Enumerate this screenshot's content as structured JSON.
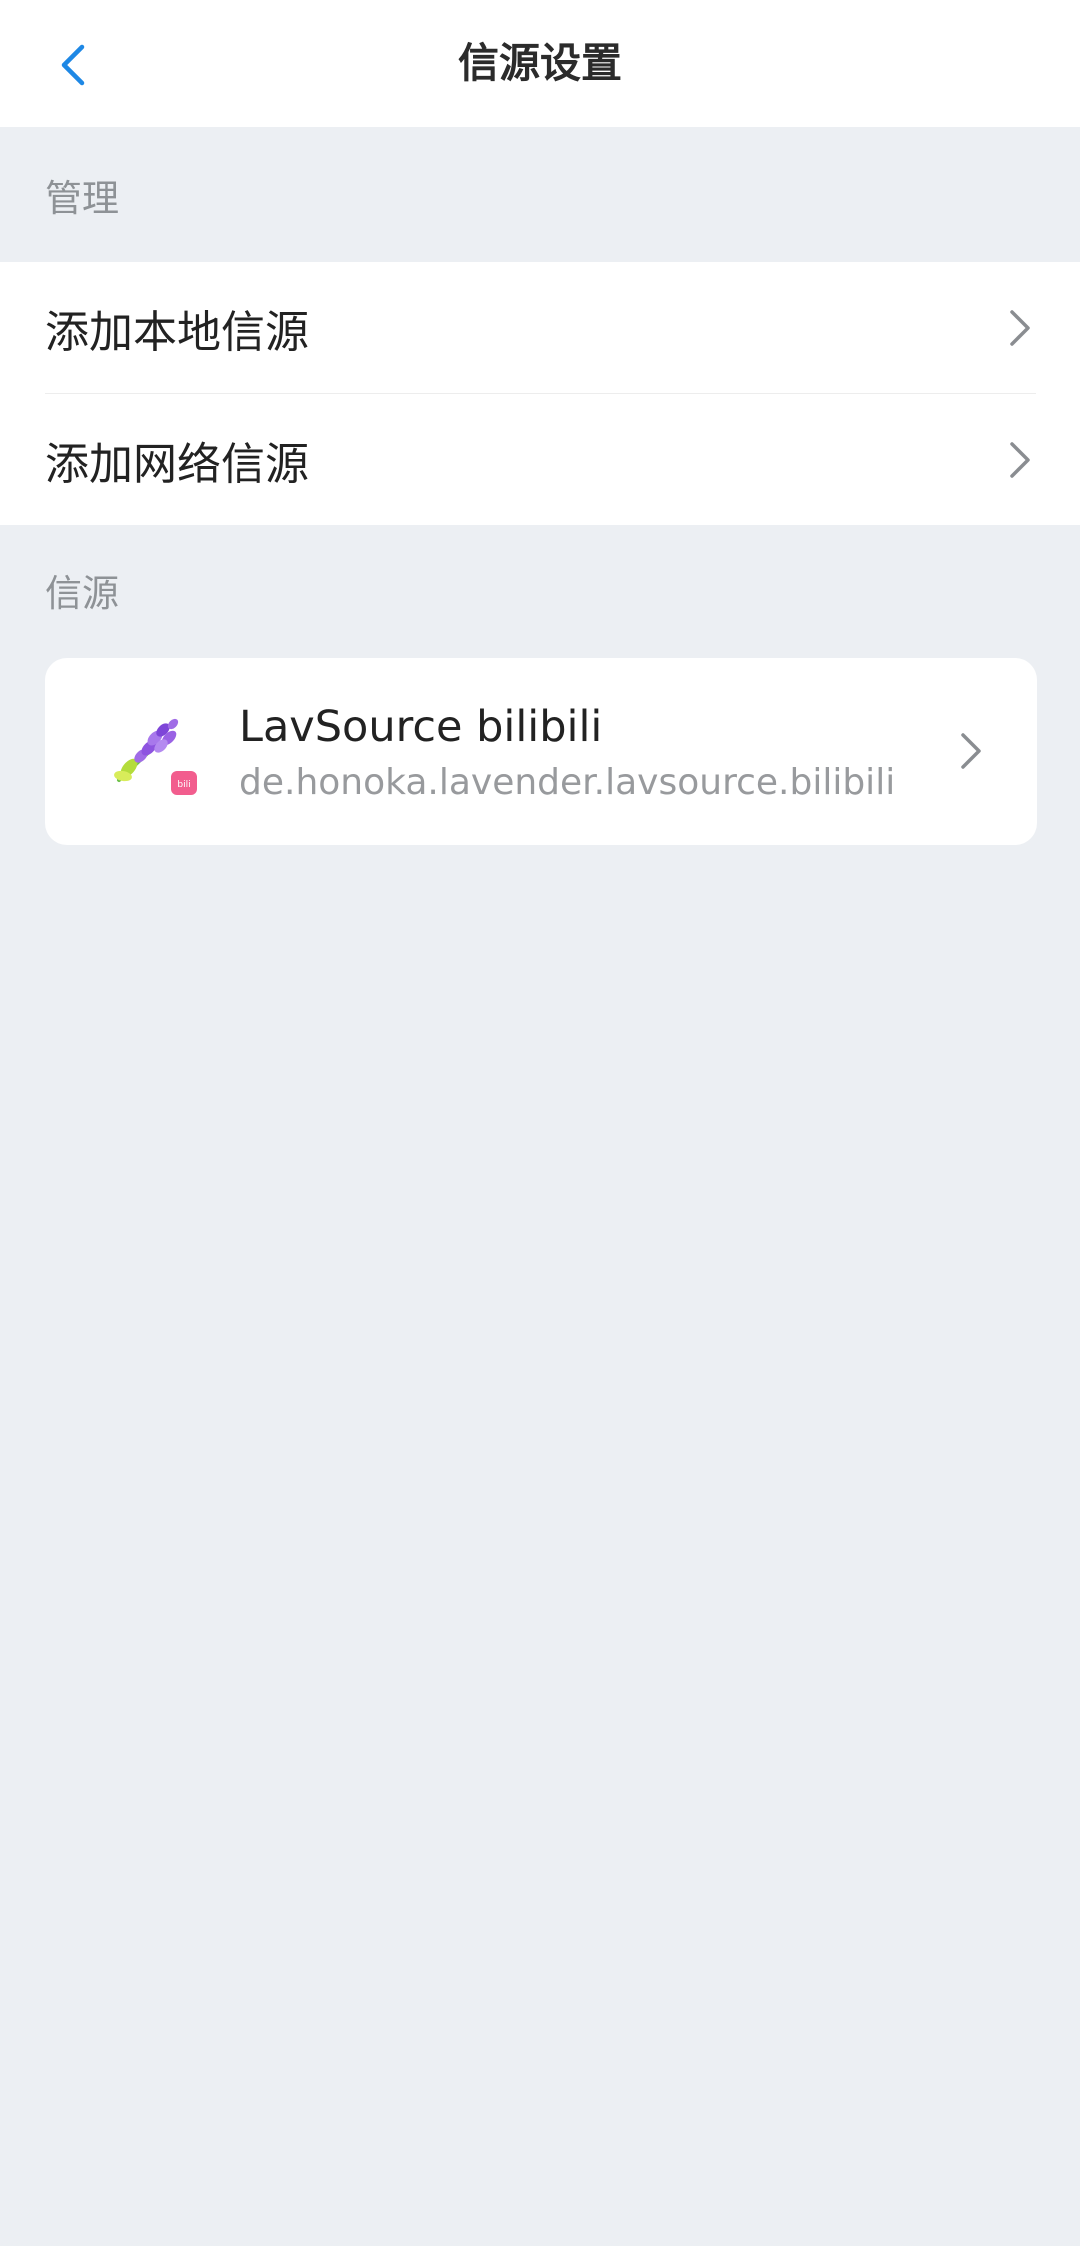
{
  "header": {
    "title": "信源设置",
    "back_icon": "chevron-left-icon"
  },
  "manage_section": {
    "label": "管理",
    "items": [
      {
        "label": "添加本地信源"
      },
      {
        "label": "添加网络信源"
      }
    ]
  },
  "sources_section": {
    "label": "信源",
    "items": [
      {
        "name": "LavSource bilibili",
        "package": "de.honoka.lavender.lavsource.bilibili",
        "icon": "lavender-icon",
        "badge_icon": "bilibili-icon"
      }
    ]
  },
  "colors": {
    "accent": "#1E88E5",
    "background": "#ECEFF3",
    "surface": "#FFFFFF",
    "primary_text": "#222222",
    "secondary_text": "#8E9296",
    "bilibili_pink": "#F25D8E"
  }
}
